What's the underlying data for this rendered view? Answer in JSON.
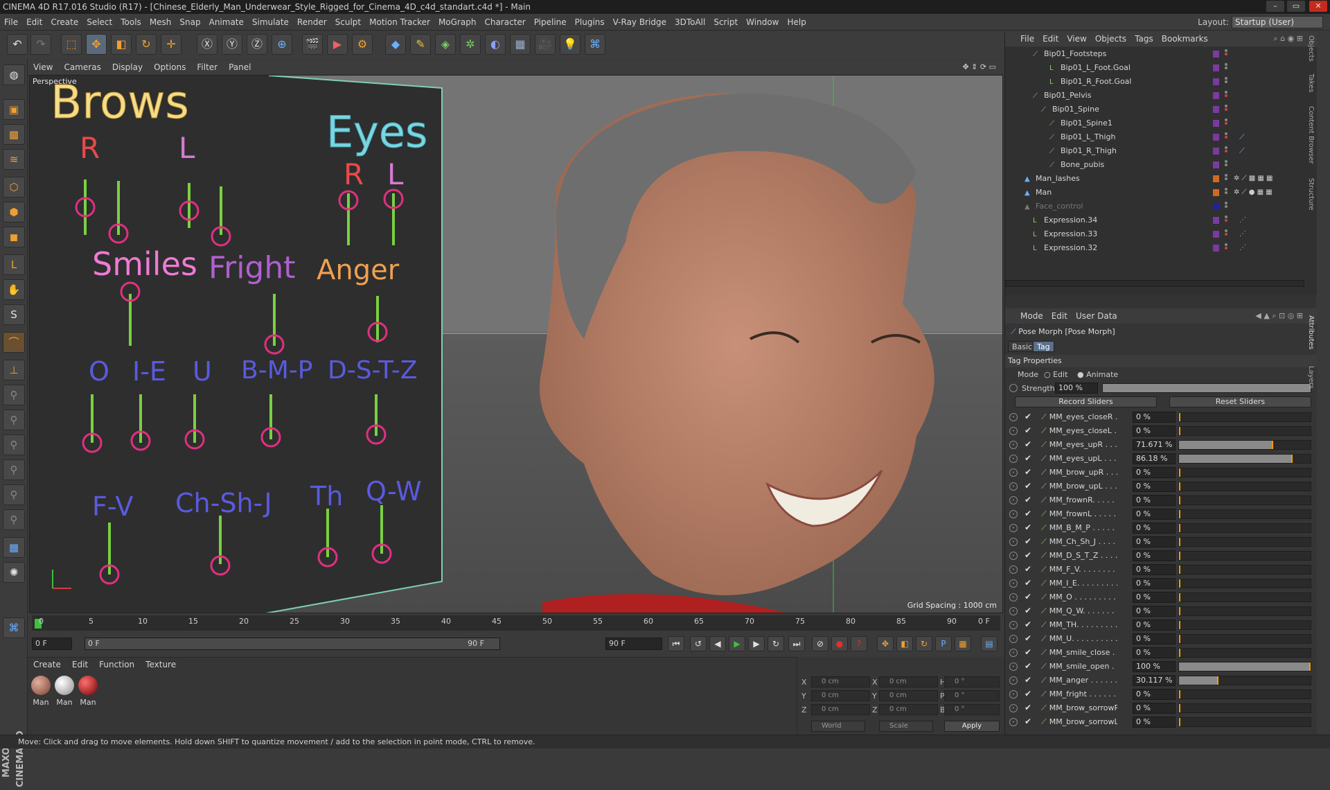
{
  "window": {
    "title": "CINEMA 4D R17.016 Studio (R17) - [Chinese_Elderly_Man_Underwear_Style_Rigged_for_Cinema_4D_c4d_standart.c4d *] - Main"
  },
  "menu": [
    "File",
    "Edit",
    "Create",
    "Select",
    "Tools",
    "Mesh",
    "Snap",
    "Animate",
    "Simulate",
    "Render",
    "Sculpt",
    "Motion Tracker",
    "MoGraph",
    "Character",
    "Pipeline",
    "Plugins",
    "V-Ray Bridge",
    "3DToAll",
    "Script",
    "Window",
    "Help"
  ],
  "layout": {
    "label": "Layout:",
    "value": "Startup (User)"
  },
  "viewport": {
    "menu": [
      "View",
      "Cameras",
      "Display",
      "Options",
      "Filter",
      "Panel"
    ],
    "label": "Perspective",
    "grid": "Grid Spacing : 1000 cm",
    "face_panel": {
      "brows": "Brows",
      "brows_r": "R",
      "brows_l": "L",
      "eyes": "Eyes",
      "eyes_r": "R",
      "eyes_l": "L",
      "smiles": "Smiles",
      "fright": "Fright",
      "anger": "Anger",
      "phonemes": [
        "O",
        "I-E",
        "U",
        "B-M-P",
        "D-S-T-Z"
      ],
      "phonemes2": [
        "F-V",
        "Ch-Sh-J",
        "Th",
        "Q-W"
      ]
    }
  },
  "timeline": {
    "ticks": [
      "0",
      "5",
      "10",
      "15",
      "20",
      "25",
      "30",
      "35",
      "40",
      "45",
      "50",
      "55",
      "60",
      "65",
      "70",
      "75",
      "80",
      "85",
      "90"
    ],
    "current_frame": "0 F",
    "start": "0 F",
    "range_start": "0 F",
    "range_end": "90 F",
    "end": "90 F",
    "frame_right": "0 F"
  },
  "materials": {
    "menu": [
      "Create",
      "Edit",
      "Function",
      "Texture"
    ],
    "items": [
      {
        "label": "Man"
      },
      {
        "label": "Man"
      },
      {
        "label": "Man"
      }
    ]
  },
  "coords": {
    "x_pos": "0 cm",
    "y_pos": "0 cm",
    "z_pos": "0 cm",
    "x_size": "0 cm",
    "y_size": "0 cm",
    "z_size": "0 cm",
    "h": "0 °",
    "p": "0 °",
    "b": "0 °",
    "mode": "World",
    "scale": "Scale",
    "apply": "Apply",
    "lbl_x": "X",
    "lbl_y": "Y",
    "lbl_z": "Z",
    "lbl_h": "H",
    "lbl_p": "P",
    "lbl_b": "B"
  },
  "objects": {
    "menu": [
      "File",
      "Edit",
      "View",
      "Objects",
      "Tags",
      "Bookmarks"
    ],
    "rows": [
      {
        "name": "Bip01_Footsteps"
      },
      {
        "name": "Bip01_L_Foot.Goal"
      },
      {
        "name": "Bip01_R_Foot.Goal"
      },
      {
        "name": "Bip01_Pelvis"
      },
      {
        "name": "Bip01_Spine"
      },
      {
        "name": "Bip01_Spine1"
      },
      {
        "name": "Bip01_L_Thigh"
      },
      {
        "name": "Bip01_R_Thigh"
      },
      {
        "name": "Bone_pubis"
      },
      {
        "name": "Man_lashes"
      },
      {
        "name": "Man"
      },
      {
        "name": "Face_control"
      },
      {
        "name": "Expression.34"
      },
      {
        "name": "Expression.33"
      },
      {
        "name": "Expression.32"
      }
    ]
  },
  "attributes": {
    "menu": [
      "Mode",
      "Edit",
      "User Data"
    ],
    "title": "Pose Morph [Pose Morph]",
    "tabs": [
      "Basic",
      "Tag"
    ],
    "section": "Tag Properties",
    "mode_label": "Mode",
    "mode_edit": "Edit",
    "mode_animate": "Animate",
    "strength_label": "Strength",
    "strength_value": "100 %",
    "record": "Record Sliders",
    "reset": "Reset Sliders",
    "sliders": [
      {
        "name": "MM_eyes_closeR . . .",
        "value": "0 %",
        "level": 0
      },
      {
        "name": "MM_eyes_closeL . . .",
        "value": "0 %",
        "level": 0
      },
      {
        "name": "MM_eyes_upR . . . . .",
        "value": "71.671 %",
        "level": 0.71671
      },
      {
        "name": "MM_eyes_upL . . . . .",
        "value": "86.18 %",
        "level": 0.8618
      },
      {
        "name": "MM_brow_upR . . . . .",
        "value": "0 %",
        "level": 0
      },
      {
        "name": "MM_brow_upL . . . . .",
        "value": "0 %",
        "level": 0
      },
      {
        "name": "MM_frownR. . . . . . .",
        "value": "0 %",
        "level": 0
      },
      {
        "name": "MM_frownL . . . . . . .",
        "value": "0 %",
        "level": 0
      },
      {
        "name": "MM_B_M_P . . . . . . .",
        "value": "0 %",
        "level": 0
      },
      {
        "name": "MM_Ch_Sh_J . . . . . .",
        "value": "0 %",
        "level": 0
      },
      {
        "name": "MM_D_S_T_Z . . . . . .",
        "value": "0 %",
        "level": 0
      },
      {
        "name": "MM_F_V. . . . . . . . .",
        "value": "0 %",
        "level": 0
      },
      {
        "name": "MM_I_E. . . . . . . . .",
        "value": "0 %",
        "level": 0
      },
      {
        "name": "MM_O . . . . . . . . . .",
        "value": "0 %",
        "level": 0
      },
      {
        "name": "MM_Q_W. . . . . . . . .",
        "value": "0 %",
        "level": 0
      },
      {
        "name": "MM_TH. . . . . . . . . .",
        "value": "0 %",
        "level": 0
      },
      {
        "name": "MM_U. . . . . . . . . . .",
        "value": "0 %",
        "level": 0
      },
      {
        "name": "MM_smile_close . . .",
        "value": "0 %",
        "level": 0
      },
      {
        "name": "MM_smile_open . . . .",
        "value": "100 %",
        "level": 1
      },
      {
        "name": "MM_anger . . . . . . .",
        "value": "30.117 %",
        "level": 0.30117
      },
      {
        "name": "MM_fright . . . . . . .",
        "value": "0 %",
        "level": 0
      },
      {
        "name": "MM_brow_sorrowR . .",
        "value": "0 %",
        "level": 0
      },
      {
        "name": "MM_brow_sorrowL . . .",
        "value": "0 %",
        "level": 0
      }
    ]
  },
  "side_tabs": [
    "Objects",
    "Takes",
    "Content Browser",
    "Structure",
    "Attributes",
    "Layers"
  ],
  "status": "Move: Click and drag to move elements. Hold down SHIFT to quantize movement / add to the selection in point mode, CTRL to remove."
}
